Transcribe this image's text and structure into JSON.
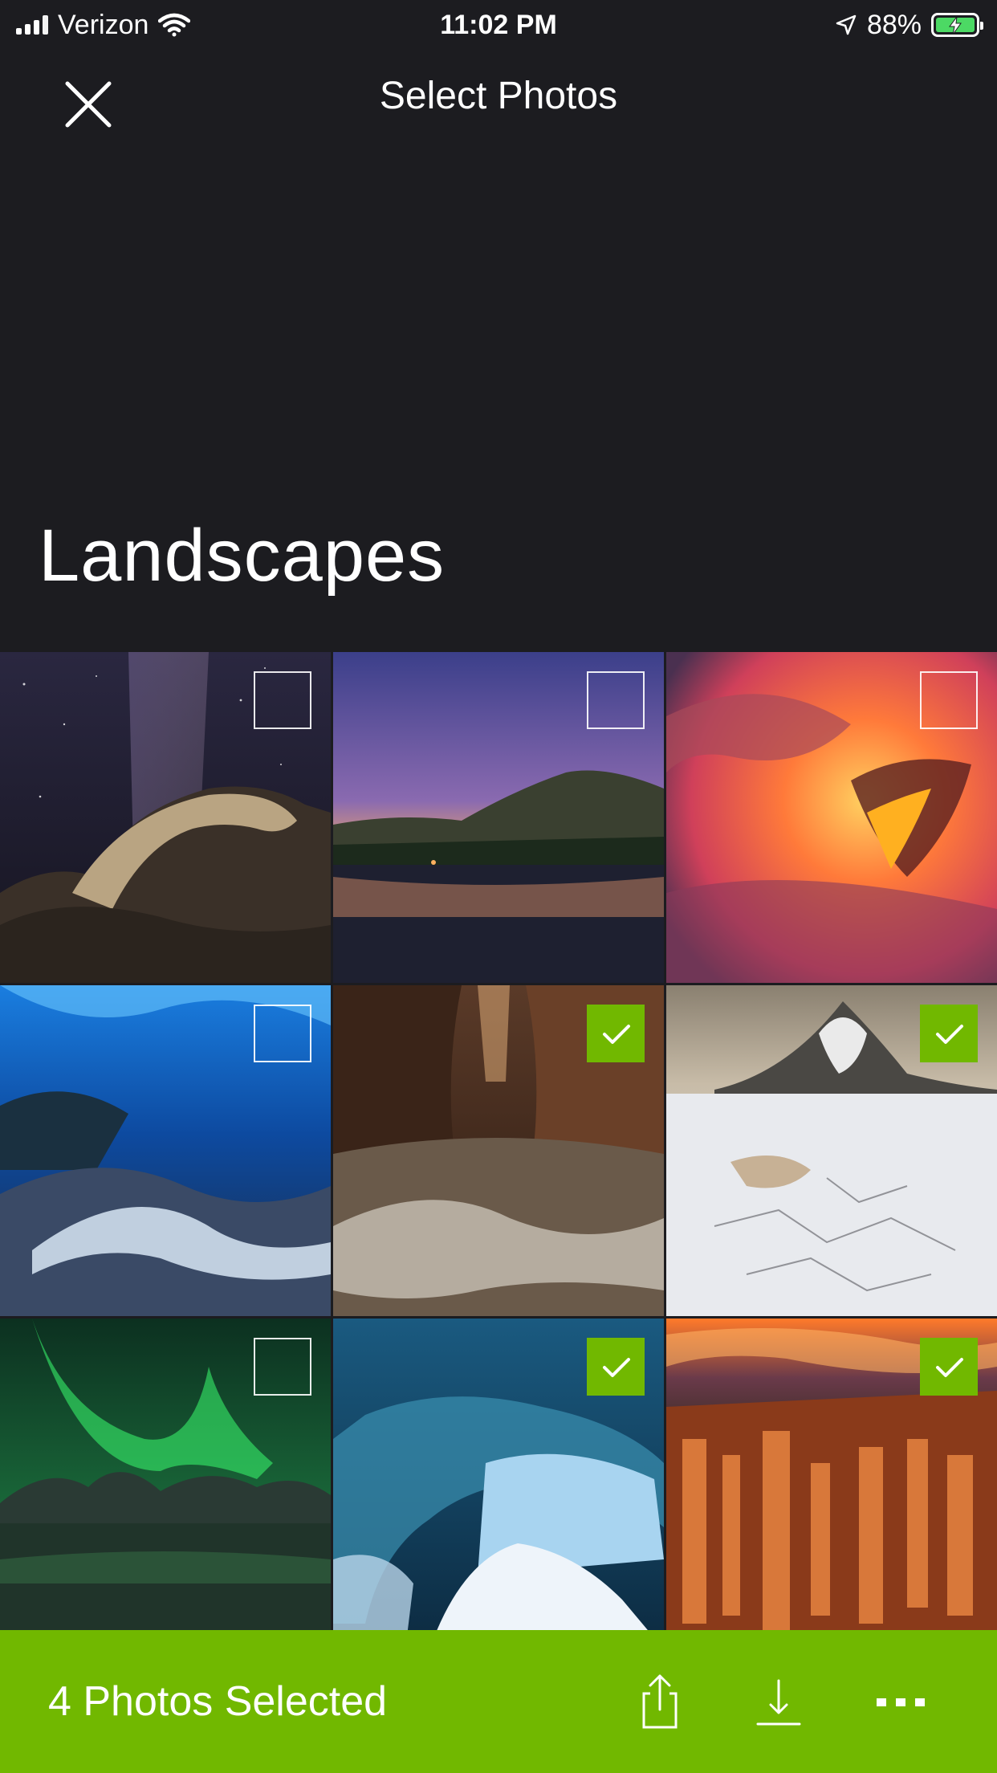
{
  "status_bar": {
    "carrier": "Verizon",
    "time": "11:02 PM",
    "battery_percent": "88%",
    "battery_color": "#4cd964"
  },
  "nav": {
    "title": "Select Photos",
    "close_icon": "close-icon"
  },
  "album": {
    "title": "Landscapes"
  },
  "photos": [
    {
      "subject": "milky-way-arch",
      "selected": false
    },
    {
      "subject": "mountain-lake-twilight",
      "selected": false
    },
    {
      "subject": "lava-wave",
      "selected": false
    },
    {
      "subject": "ice-cave-river",
      "selected": false
    },
    {
      "subject": "slot-canyon-stream",
      "selected": true
    },
    {
      "subject": "snowy-peak-frozen-lake",
      "selected": true
    },
    {
      "subject": "aurora-mountains",
      "selected": false
    },
    {
      "subject": "ice-cave-blue",
      "selected": true
    },
    {
      "subject": "hoodoo-canyon-sunrise",
      "selected": true
    }
  ],
  "bottom_bar": {
    "selected_label": "4 Photos Selected",
    "accent_color": "#71b800",
    "actions": [
      "share-icon",
      "download-icon",
      "more-icon"
    ]
  }
}
